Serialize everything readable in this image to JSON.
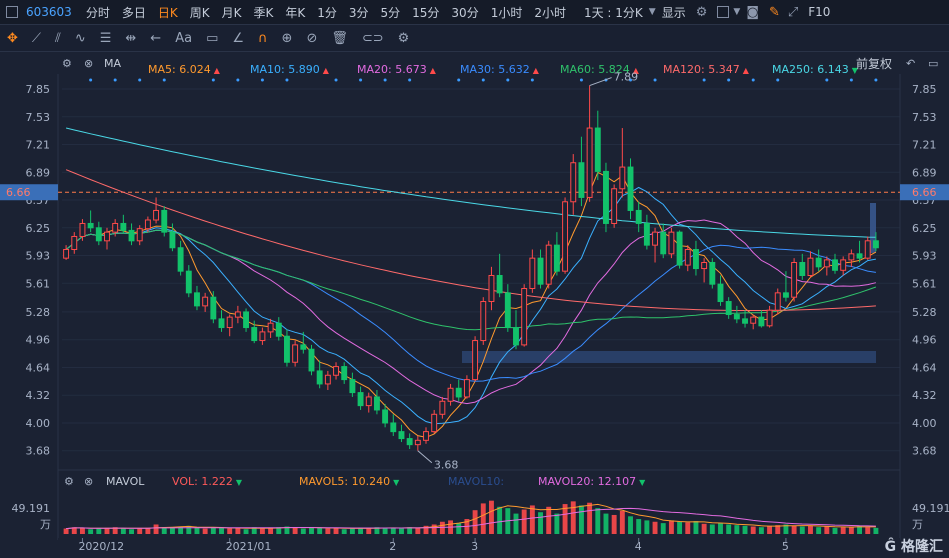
{
  "toolbar": {
    "stock_code": "603603",
    "periods": [
      "分时",
      "多日",
      "日K",
      "周K",
      "月K",
      "季K",
      "年K",
      "1分",
      "3分",
      "5分",
      "15分",
      "30分",
      "1小时",
      "2小时"
    ],
    "active_period": "日K",
    "interval_select": "1天 : 1分K",
    "display_label": "显示",
    "f10_label": "F10"
  },
  "drawing_tools": {
    "text_tool": "Aa"
  },
  "ma_legend": {
    "name": "MA",
    "items": [
      {
        "label": "MA5: 6.024",
        "color": "#ff9a2e",
        "dir": "up"
      },
      {
        "label": "MA10: 5.890",
        "color": "#3ab0ff",
        "dir": "up"
      },
      {
        "label": "MA20: 5.673",
        "color": "#e26be0",
        "dir": "up"
      },
      {
        "label": "MA30: 5.632",
        "color": "#3a8cff",
        "dir": "up"
      },
      {
        "label": "MA60: 5.824",
        "color": "#2fc26b",
        "dir": "up"
      },
      {
        "label": "MA120: 5.347",
        "color": "#ff6a6a",
        "dir": "up"
      },
      {
        "label": "MA250: 6.143",
        "color": "#4ad8e6",
        "dir": "down"
      }
    ],
    "adjust_label": "前复权"
  },
  "vol_legend": {
    "name": "MAVOL",
    "items": [
      {
        "label": "VOL: 1.222",
        "color": "#ff5a5a",
        "dir": "down"
      },
      {
        "label": "MAVOL5: 10.240",
        "color": "#ff9a2e",
        "dir": "down"
      },
      {
        "label": "MAVOL10:",
        "color": "#2a4d8f",
        "dir": ""
      },
      {
        "label": "MAVOL20: 12.107",
        "color": "#e26be0",
        "dir": "down"
      }
    ]
  },
  "chart_data": {
    "type": "candlestick",
    "price_axis_ticks": [
      "7.85",
      "7.53",
      "7.21",
      "6.89",
      "6.57",
      "6.25",
      "5.93",
      "5.61",
      "5.28",
      "4.96",
      "4.64",
      "4.32",
      "4.00",
      "3.68"
    ],
    "current_price_label": "6.66",
    "high_annotation": "7.89",
    "low_annotation": "3.68",
    "volume_axis_max_label": "49.191",
    "volume_unit_label": "万",
    "date_labels": [
      "2020/12",
      "2021/01",
      "2",
      "3",
      "4",
      "5"
    ],
    "up_color": "#ff4a4a",
    "down_color": "#12c26b",
    "ohlc": [
      [
        5.9,
        6.05,
        5.88,
        6.0
      ],
      [
        6.0,
        6.2,
        5.95,
        6.15
      ],
      [
        6.15,
        6.35,
        6.1,
        6.3
      ],
      [
        6.3,
        6.45,
        6.2,
        6.25
      ],
      [
        6.25,
        6.32,
        6.05,
        6.1
      ],
      [
        6.1,
        6.25,
        6.0,
        6.2
      ],
      [
        6.2,
        6.35,
        6.15,
        6.3
      ],
      [
        6.3,
        6.4,
        6.18,
        6.22
      ],
      [
        6.22,
        6.3,
        6.05,
        6.1
      ],
      [
        6.1,
        6.28,
        6.05,
        6.24
      ],
      [
        6.24,
        6.38,
        6.2,
        6.34
      ],
      [
        6.34,
        6.6,
        6.3,
        6.45
      ],
      [
        6.45,
        6.5,
        6.15,
        6.2
      ],
      [
        6.2,
        6.3,
        5.98,
        6.02
      ],
      [
        6.02,
        6.1,
        5.7,
        5.75
      ],
      [
        5.75,
        5.82,
        5.45,
        5.5
      ],
      [
        5.5,
        5.58,
        5.3,
        5.35
      ],
      [
        5.35,
        5.5,
        5.28,
        5.45
      ],
      [
        5.45,
        5.52,
        5.15,
        5.2
      ],
      [
        5.2,
        5.3,
        5.05,
        5.1
      ],
      [
        5.1,
        5.25,
        5.0,
        5.22
      ],
      [
        5.22,
        5.35,
        5.15,
        5.28
      ],
      [
        5.28,
        5.32,
        5.05,
        5.1
      ],
      [
        5.1,
        5.18,
        4.92,
        4.95
      ],
      [
        4.95,
        5.1,
        4.9,
        5.05
      ],
      [
        5.05,
        5.2,
        4.98,
        5.15
      ],
      [
        5.15,
        5.22,
        4.95,
        5.0
      ],
      [
        5.0,
        5.08,
        4.65,
        4.7
      ],
      [
        4.7,
        4.95,
        4.65,
        4.9
      ],
      [
        4.9,
        5.05,
        4.8,
        4.85
      ],
      [
        4.85,
        4.9,
        4.55,
        4.6
      ],
      [
        4.6,
        4.72,
        4.4,
        4.45
      ],
      [
        4.45,
        4.6,
        4.38,
        4.55
      ],
      [
        4.55,
        4.7,
        4.5,
        4.65
      ],
      [
        4.65,
        4.7,
        4.45,
        4.5
      ],
      [
        4.5,
        4.58,
        4.3,
        4.35
      ],
      [
        4.35,
        4.42,
        4.15,
        4.2
      ],
      [
        4.2,
        4.35,
        4.12,
        4.3
      ],
      [
        4.3,
        4.38,
        4.1,
        4.15
      ],
      [
        4.15,
        4.22,
        3.95,
        4.0
      ],
      [
        4.0,
        4.1,
        3.85,
        3.9
      ],
      [
        3.9,
        3.98,
        3.78,
        3.82
      ],
      [
        3.82,
        3.88,
        3.7,
        3.75
      ],
      [
        3.75,
        3.85,
        3.68,
        3.8
      ],
      [
        3.8,
        3.95,
        3.76,
        3.9
      ],
      [
        3.9,
        4.15,
        3.88,
        4.1
      ],
      [
        4.1,
        4.3,
        4.05,
        4.25
      ],
      [
        4.25,
        4.45,
        4.2,
        4.4
      ],
      [
        4.4,
        4.5,
        4.25,
        4.3
      ],
      [
        4.3,
        4.55,
        4.28,
        4.5
      ],
      [
        4.5,
        5.0,
        4.48,
        4.95
      ],
      [
        4.95,
        5.45,
        4.9,
        5.4
      ],
      [
        5.4,
        5.8,
        5.3,
        5.7
      ],
      [
        5.7,
        5.95,
        5.45,
        5.5
      ],
      [
        5.5,
        5.6,
        5.05,
        5.1
      ],
      [
        5.1,
        5.3,
        4.85,
        4.9
      ],
      [
        4.9,
        5.6,
        4.88,
        5.55
      ],
      [
        5.55,
        6.0,
        5.5,
        5.9
      ],
      [
        5.9,
        6.0,
        5.55,
        5.6
      ],
      [
        5.6,
        6.1,
        5.55,
        6.05
      ],
      [
        6.05,
        6.2,
        5.7,
        5.75
      ],
      [
        5.75,
        6.6,
        5.72,
        6.55
      ],
      [
        6.55,
        7.1,
        6.4,
        7.0
      ],
      [
        7.0,
        7.3,
        6.5,
        6.6
      ],
      [
        6.6,
        7.89,
        6.55,
        7.4
      ],
      [
        7.4,
        7.6,
        6.8,
        6.9
      ],
      [
        6.9,
        7.0,
        6.2,
        6.3
      ],
      [
        6.3,
        6.75,
        6.25,
        6.7
      ],
      [
        6.7,
        7.4,
        6.6,
        6.95
      ],
      [
        6.95,
        7.05,
        6.35,
        6.45
      ],
      [
        6.45,
        6.55,
        6.2,
        6.3
      ],
      [
        6.3,
        6.4,
        6.0,
        6.05
      ],
      [
        6.05,
        6.25,
        5.85,
        6.2
      ],
      [
        6.2,
        6.3,
        5.9,
        5.95
      ],
      [
        5.95,
        6.25,
        5.9,
        6.2
      ],
      [
        6.2,
        6.22,
        5.78,
        5.82
      ],
      [
        5.82,
        6.05,
        5.75,
        6.0
      ],
      [
        6.0,
        6.1,
        5.7,
        5.78
      ],
      [
        5.78,
        5.9,
        5.62,
        5.85
      ],
      [
        5.85,
        5.9,
        5.55,
        5.6
      ],
      [
        5.6,
        5.7,
        5.35,
        5.4
      ],
      [
        5.4,
        5.45,
        5.2,
        5.25
      ],
      [
        5.25,
        5.35,
        5.15,
        5.2
      ],
      [
        5.2,
        5.3,
        5.1,
        5.15
      ],
      [
        5.15,
        5.25,
        5.08,
        5.22
      ],
      [
        5.22,
        5.3,
        5.1,
        5.12
      ],
      [
        5.12,
        5.35,
        5.1,
        5.3
      ],
      [
        5.3,
        5.55,
        5.25,
        5.5
      ],
      [
        5.5,
        5.75,
        5.4,
        5.45
      ],
      [
        5.45,
        5.9,
        5.4,
        5.85
      ],
      [
        5.85,
        5.95,
        5.65,
        5.7
      ],
      [
        5.7,
        5.98,
        5.68,
        5.9
      ],
      [
        5.9,
        6.0,
        5.75,
        5.8
      ],
      [
        5.8,
        5.92,
        5.7,
        5.88
      ],
      [
        5.88,
        5.95,
        5.72,
        5.76
      ],
      [
        5.76,
        5.92,
        5.7,
        5.88
      ],
      [
        5.88,
        6.0,
        5.8,
        5.95
      ],
      [
        5.95,
        6.1,
        5.85,
        5.9
      ],
      [
        5.9,
        6.15,
        5.88,
        6.1
      ],
      [
        6.1,
        6.2,
        5.98,
        6.02
      ]
    ],
    "volume": [
      8,
      10,
      9,
      7,
      8,
      9,
      10,
      8,
      7,
      8,
      9,
      14,
      10,
      9,
      11,
      12,
      9,
      8,
      10,
      9,
      8,
      9,
      7,
      10,
      8,
      9,
      10,
      11,
      9,
      8,
      10,
      9,
      8,
      9,
      7,
      8,
      9,
      8,
      10,
      9,
      9,
      8,
      10,
      9,
      12,
      14,
      18,
      20,
      16,
      22,
      35,
      45,
      49,
      40,
      38,
      30,
      36,
      42,
      32,
      40,
      30,
      44,
      48,
      42,
      46,
      38,
      30,
      28,
      34,
      26,
      22,
      20,
      18,
      16,
      20,
      18,
      17,
      19,
      15,
      14,
      16,
      14,
      13,
      12,
      11,
      10,
      12,
      13,
      14,
      12,
      11,
      12,
      10,
      11,
      9,
      10,
      11,
      12,
      10,
      9
    ]
  }
}
